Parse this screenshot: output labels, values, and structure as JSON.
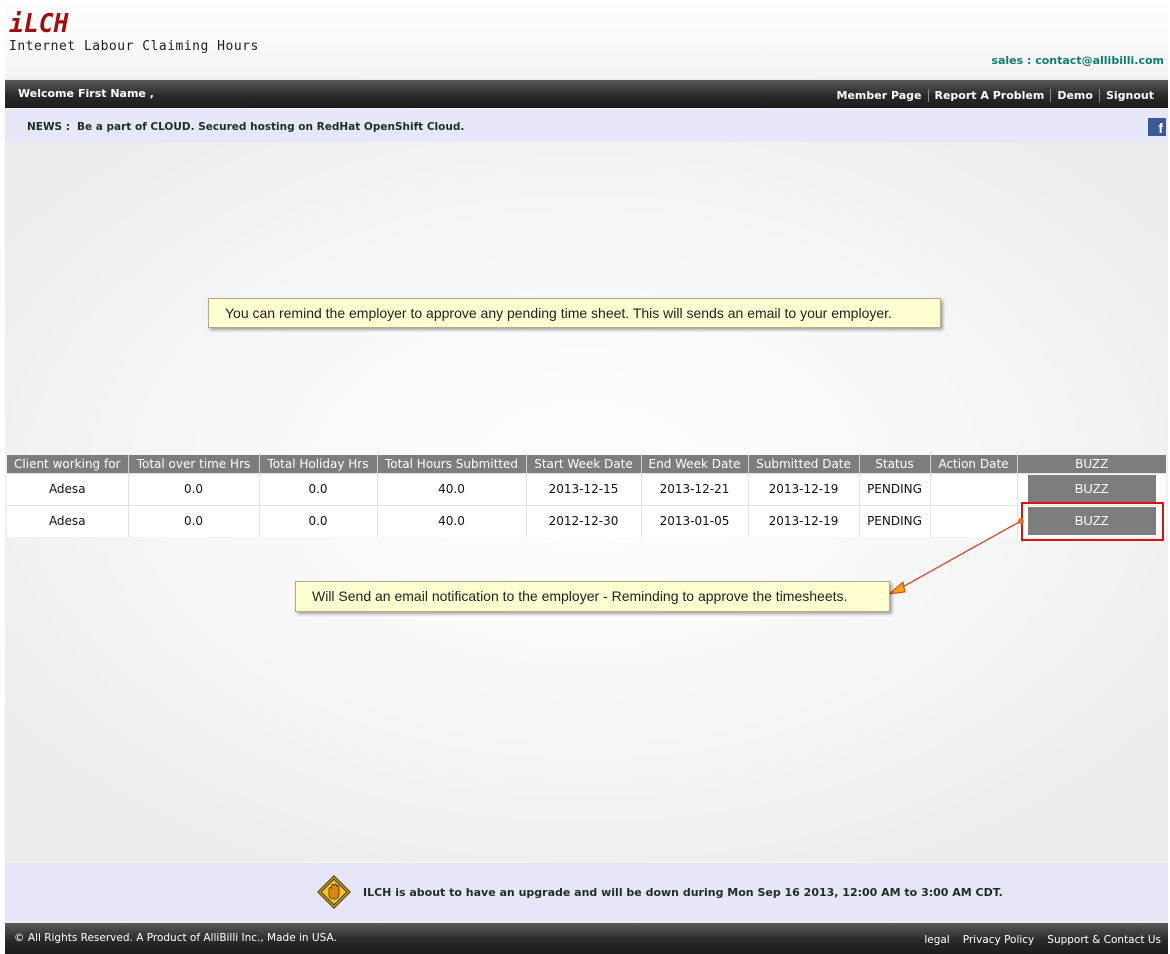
{
  "header": {
    "logo": "iLCH",
    "tagline": "Internet Labour Claiming Hours",
    "sales": "sales : contact@allibilli.com"
  },
  "topbar": {
    "welcome": "Welcome",
    "user": "First Name ,",
    "links": [
      "Member Page",
      "Report A Problem",
      "Demo",
      "Signout"
    ]
  },
  "news": {
    "label": "NEWS :",
    "text": "Be a part of CLOUD. Secured hosting on RedHat OpenShift Cloud.",
    "facebook": "f"
  },
  "tips": {
    "top": "You can remind the employer to approve any pending time sheet. This will sends an email to your employer.",
    "bottom": "Will Send an email notification to the employer - Reminding to approve the timesheets."
  },
  "table": {
    "headers": [
      "Client working for",
      "Total over time Hrs",
      "Total Holiday Hrs",
      "Total Hours Submitted",
      "Start Week Date",
      "End Week Date",
      "Submitted Date",
      "Status",
      "Action Date",
      "BUZZ"
    ],
    "rows": [
      {
        "client": "Adesa",
        "overtime": "0.0",
        "holiday": "0.0",
        "total": "40.0",
        "start": "2013-12-15",
        "end": "2013-12-21",
        "submitted": "2013-12-19",
        "status": "PENDING",
        "action_date": "",
        "buzz": "BUZZ"
      },
      {
        "client": "Adesa",
        "overtime": "0.0",
        "holiday": "0.0",
        "total": "40.0",
        "start": "2012-12-30",
        "end": "2013-01-05",
        "submitted": "2013-12-19",
        "status": "PENDING",
        "action_date": "",
        "buzz": "BUZZ"
      }
    ]
  },
  "notice": {
    "icon": "stop-hand-icon",
    "text": "ILCH is about to have an upgrade and will be down during Mon Sep 16 2013, 12:00 AM to 3:00 AM CDT."
  },
  "footer": {
    "copyright": "© All Rights Reserved. A Product of AlliBilli Inc., Made in USA.",
    "links": [
      "legal",
      "Privacy Policy",
      "Support & Contact Us"
    ]
  },
  "colors": {
    "logo": "#a01010",
    "sales": "#117a72",
    "table_header": "#7d7d7d",
    "highlight": "#dd1111",
    "tooltip_bg": "#ffffd2",
    "facebook": "#3b5998"
  }
}
